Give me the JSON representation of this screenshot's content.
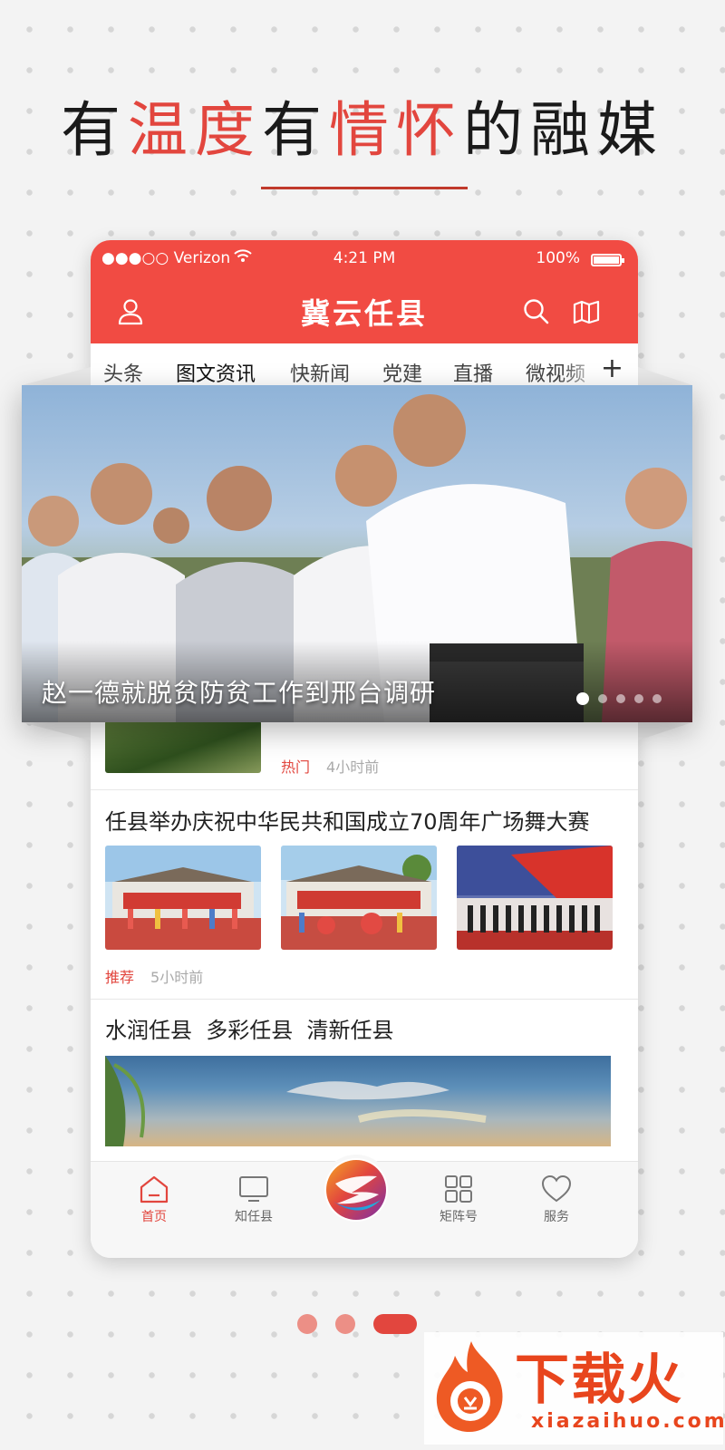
{
  "headline": {
    "p1": "有",
    "p2": "温度",
    "p3": "有",
    "p4": "情怀",
    "p5": "的融媒"
  },
  "status_bar": {
    "carrier": "●●●○○ Verizon",
    "time": "4:21 PM",
    "battery": "100%"
  },
  "app": {
    "title": "冀云任县"
  },
  "tabs": [
    "头条",
    "图文资讯",
    "快新闻",
    "党建",
    "直播",
    "微视频"
  ],
  "tab_active": "图文资讯",
  "hero": {
    "caption": "赵一德就脱贫防贫工作到邢台调研",
    "slide_count": 5,
    "active_slide": 1
  },
  "articles": [
    {
      "title": "",
      "tag": "热门",
      "time": "4小时前"
    },
    {
      "title": "任县举办庆祝中华民共和国成立70周年广场舞大赛",
      "tag": "推荐",
      "time": "5小时前"
    },
    {
      "title": "水润任县  多彩任县  清新任县"
    }
  ],
  "tabbar": {
    "home": "首页",
    "know": "知任县",
    "matrix": "矩阵号",
    "service": "服务"
  },
  "pager": {
    "count": 3,
    "active": 3
  },
  "watermark": {
    "brand": "下载火",
    "url": "xiazaihuo.com"
  },
  "colors": {
    "primary": "#f14b43",
    "accent": "#e2463e"
  }
}
